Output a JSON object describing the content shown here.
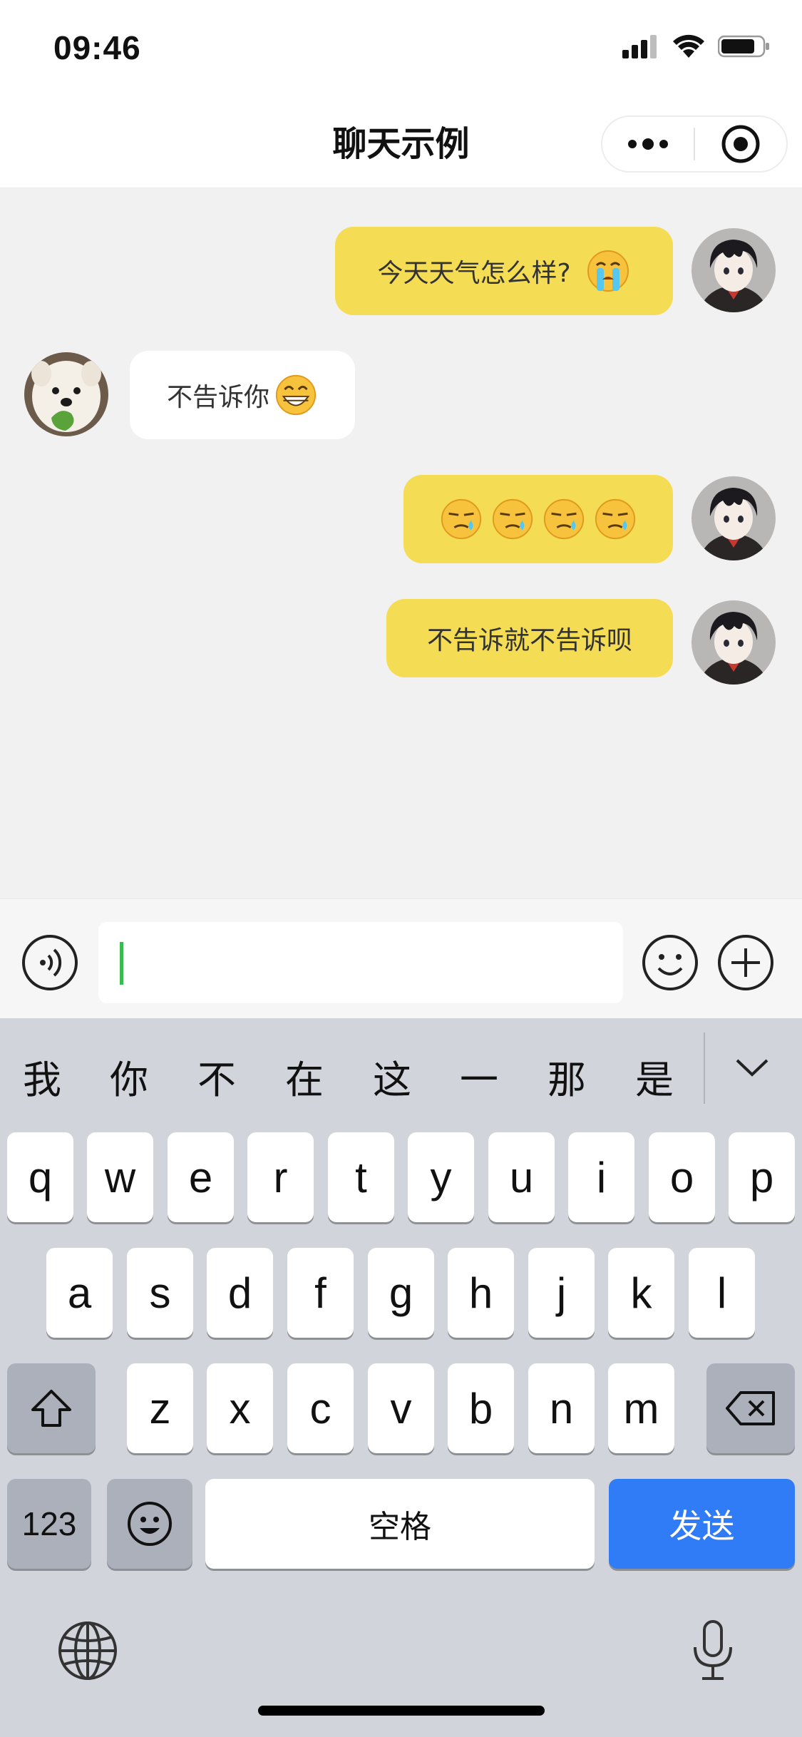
{
  "status_bar": {
    "time": "09:46"
  },
  "nav": {
    "title": "聊天示例"
  },
  "messages": [
    {
      "from": "me",
      "text": "今天天气怎么样?",
      "emoji": "crying-face"
    },
    {
      "from": "other",
      "text": "不告诉你",
      "emoji": "grinning-face"
    },
    {
      "from": "me",
      "text": "",
      "emoji": "smirk-sweat-face x4"
    },
    {
      "from": "me",
      "text": "不告诉就不告诉呗",
      "emoji": ""
    }
  ],
  "input": {
    "value": "",
    "placeholder": ""
  },
  "keyboard": {
    "candidates": [
      "我",
      "你",
      "不",
      "在",
      "这",
      "一",
      "那",
      "是"
    ],
    "row1": [
      "q",
      "w",
      "e",
      "r",
      "t",
      "y",
      "u",
      "i",
      "o",
      "p"
    ],
    "row2": [
      "a",
      "s",
      "d",
      "f",
      "g",
      "h",
      "j",
      "k",
      "l"
    ],
    "row3": [
      "z",
      "x",
      "c",
      "v",
      "b",
      "n",
      "m"
    ],
    "numbers_label": "123",
    "space_label": "空格",
    "send_label": "发送"
  },
  "colors": {
    "my_bubble": "#f4dc55",
    "their_bubble": "#ffffff",
    "send_key": "#2f7cf6",
    "caret": "#3cb950"
  }
}
